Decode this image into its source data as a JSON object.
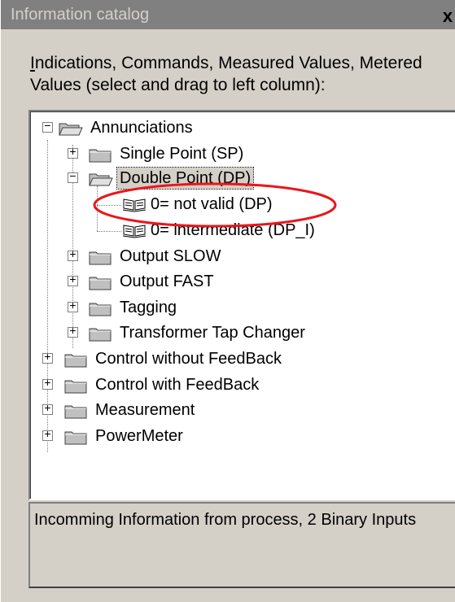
{
  "window": {
    "title": "Information catalog",
    "close_glyph": "x"
  },
  "instructions": {
    "hotkey_letter": "I",
    "text_rest": "ndications, Commands, Measured Values, Metered Values (select and drag to left column):"
  },
  "tree": {
    "annunciations": "Annunciations",
    "single_point": "Single Point (SP)",
    "double_point": "Double Point (DP)",
    "not_valid": "0= not valid (DP)",
    "intermediate": "0= intermediate (DP_I)",
    "output_slow": "Output SLOW",
    "output_fast": "Output FAST",
    "tagging": "Tagging",
    "tap_changer": "Transformer Tap Changer",
    "control_without_feedback": "Control without FeedBack",
    "control_with_feedback": "Control with FeedBack",
    "measurement": "Measurement",
    "powermeter": "PowerMeter"
  },
  "status": {
    "text": "Incomming Information from process, 2 Binary Inputs"
  },
  "colors": {
    "highlight_ellipse": "#e8171b",
    "folder": "#c0c0c0",
    "panel_bg": "#d4d0c8"
  },
  "icons": {
    "folder": "folder-icon",
    "open_folder": "open-folder-icon",
    "info_item": "book-icon"
  }
}
